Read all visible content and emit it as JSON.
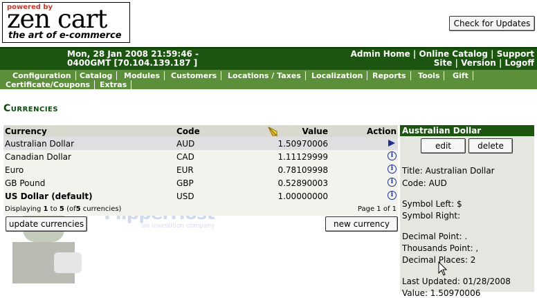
{
  "header": {
    "logo_powered": "powered by",
    "logo_word": "zen cart",
    "logo_tagline": "the art of e-commerce",
    "check_updates_label": "Check for Updates"
  },
  "topbar": {
    "date_line1": "Mon, 28 Jan 2008 21:59:46 -",
    "date_line2": "0400GMT [70.104.139.187 ]",
    "links_line1": "Admin Home | Online Catalog | Support",
    "links_line2": "Site | Version | Logoff"
  },
  "menu": {
    "items": [
      "Configuration",
      "Catalog",
      "Modules",
      "Customers",
      "Locations / Taxes",
      "Localization",
      "Reports",
      "Tools",
      "Gift",
      "Certificate/Coupons",
      "Extras"
    ]
  },
  "page_title": "Currencies",
  "watermark": {
    "text": "FlipperHost",
    "sub": "an investition company"
  },
  "table": {
    "headers": {
      "currency": "Currency",
      "code": "Code",
      "value": "Value",
      "action": "Action"
    },
    "rows": [
      {
        "currency": "Australian Dollar",
        "code": "AUD",
        "value": "1.50970006"
      },
      {
        "currency": "Canadian Dollar",
        "code": "CAD",
        "value": "1.11129999"
      },
      {
        "currency": "Euro",
        "code": "EUR",
        "value": "0.78109998"
      },
      {
        "currency": "GB Pound",
        "code": "GBP",
        "value": "0.52890003"
      },
      {
        "currency": "US Dollar (default)",
        "code": "USD",
        "value": "1.00000000"
      }
    ],
    "displaying_prefix": "Displaying",
    "displaying_from": "1",
    "displaying_to_word": "to",
    "displaying_to": "5",
    "displaying_of_open": "(of",
    "displaying_total": "5",
    "displaying_suffix": "currencies)",
    "page_info": "Page 1 of 1",
    "update_label": "update currencies",
    "new_label": "new currency"
  },
  "side": {
    "title": "Australian Dollar",
    "edit_label": "edit",
    "delete_label": "delete",
    "lines": {
      "title": "Title: Australian Dollar",
      "code": "Code: AUD",
      "symbol_left": "Symbol Left: $",
      "symbol_right": "Symbol Right:",
      "decimal_point": "Decimal Point: .",
      "thousands_point": "Thousands Point: ,",
      "decimal_places": "Decimal Places: 2",
      "last_updated": "Last Updated: 01/28/2008",
      "value": "Value: 1.50970006"
    }
  },
  "colors": {
    "dark_green": "#1b5510",
    "menu_green": "#5c8f3a",
    "title_green": "#0c4a0c",
    "icon_blue": "#1d2f8c"
  }
}
